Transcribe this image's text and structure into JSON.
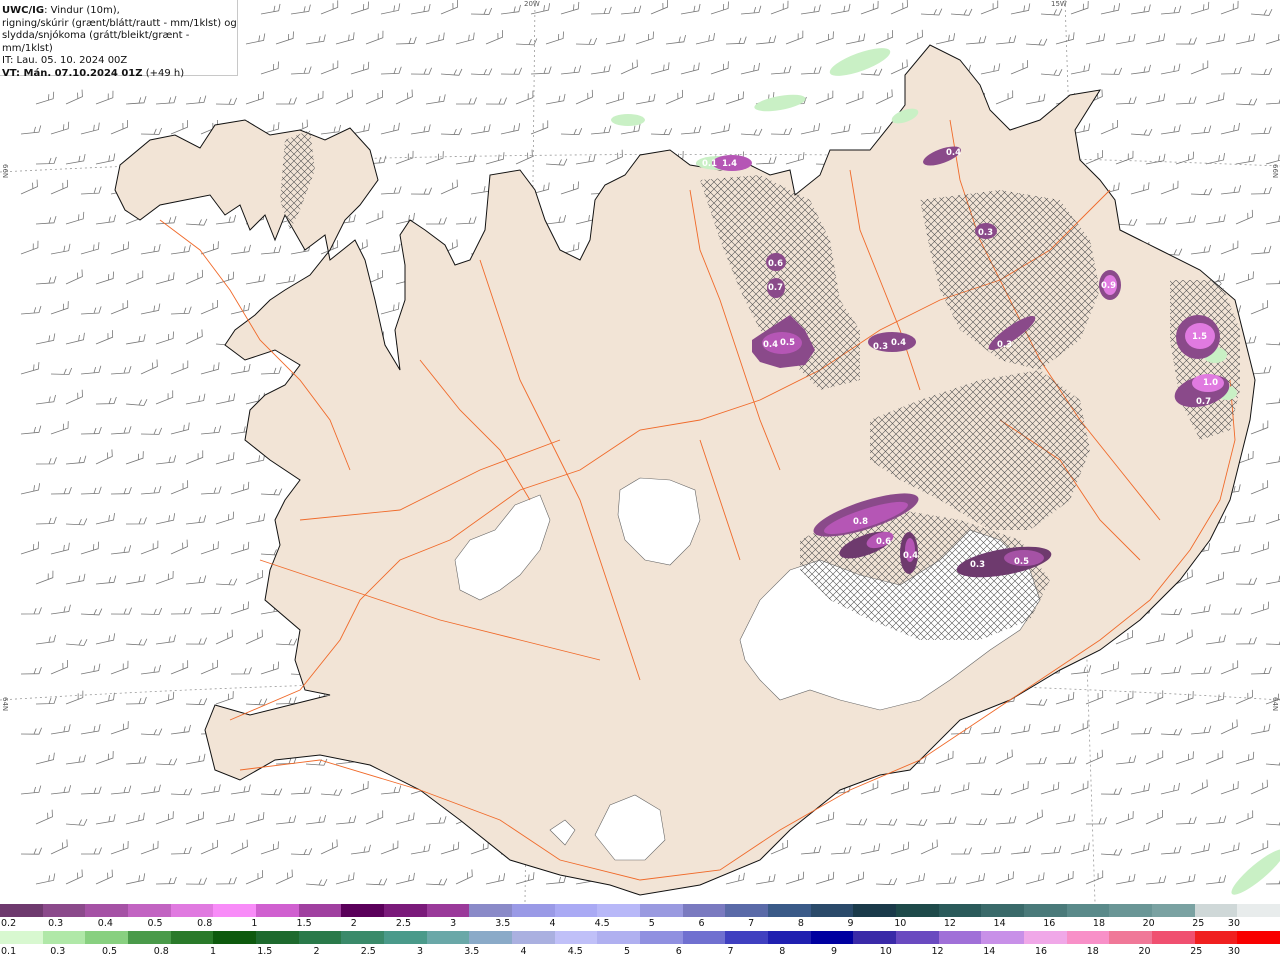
{
  "header": {
    "model": "UWC/IG",
    "line1_rest": ": Vindur (10m),",
    "line2": "rigning/skúrir (grænt/blátt/rautt - mm/1klst) og",
    "line3": "slydda/snjókoma (grátt/bleikt/grænt - mm/1klst)",
    "line4": "IT: Lau. 05. 10. 2024 00Z",
    "line5_label": "VT: Mán. 07.10.2024 01Z",
    "line5_rest": " (+49 h)"
  },
  "map_labels": {
    "lon_20w": "20W",
    "lon_15w": "15W",
    "lat_66n_left": "66N",
    "lat_66n_right": "66N",
    "lat_64n_left": "64N",
    "lat_64n_right": "64N"
  },
  "colors": {
    "land": "#f2e4d6",
    "sea": "#ffffff",
    "coast": "#111111",
    "roads": "#f06a2a",
    "glacier": "#ffffff",
    "rain": "#c9f0c5",
    "snow_light": "#8a4a8a",
    "snow_medium": "#b556b5",
    "snow_heavy": "#e07ae0"
  },
  "precip_values": [
    {
      "label": "0.1"
    },
    {
      "label": "1.4"
    },
    {
      "label": "0.4"
    },
    {
      "label": "0.3"
    },
    {
      "label": "0.6"
    },
    {
      "label": "0.7"
    },
    {
      "label": "0.4"
    },
    {
      "label": "0.5"
    },
    {
      "label": "0.3"
    },
    {
      "label": "0.4"
    },
    {
      "label": "0.3"
    },
    {
      "label": "0.9"
    },
    {
      "label": "1.5"
    },
    {
      "label": "1.0"
    },
    {
      "label": "0.7"
    },
    {
      "label": "0.8"
    },
    {
      "label": "0.6"
    },
    {
      "label": "0.4"
    },
    {
      "label": "0.3"
    },
    {
      "label": "0.5"
    }
  ],
  "legend_snow": {
    "colors": [
      "#6e3a6e",
      "#8b4a8b",
      "#a552a5",
      "#c264c2",
      "#e07ae0",
      "#f88cf8",
      "#d060d0",
      "#a040a0",
      "#5a005a",
      "#7a1a7a",
      "#9a3a9a",
      "#8a8ac8",
      "#9a9ae6",
      "#aaaaf4",
      "#b8b8f8",
      "#9a9ae0",
      "#7a7ac0",
      "#5a6aa8",
      "#3a5a88",
      "#2a4a6a",
      "#1a3a4a",
      "#1e4a4a",
      "#2a5a5a",
      "#3a6a6a",
      "#4a7a7a",
      "#5a8a8a",
      "#6a9696",
      "#7aa2a2",
      "#cfd8d8",
      "#e8ecec"
    ],
    "ticks": [
      "0.2",
      "0.3",
      "0.4",
      "0.5",
      "0.8",
      "1",
      "1.5",
      "2",
      "2.5",
      "3",
      "3.5",
      "4",
      "4.5",
      "5",
      "6",
      "7",
      "8",
      "9",
      "10",
      "12",
      "14",
      "16",
      "18",
      "20",
      "25",
      "30"
    ]
  },
  "legend_rain": {
    "colors": [
      "#d8f8d0",
      "#b0e8a8",
      "#88d080",
      "#4a9a4a",
      "#2a7a2a",
      "#0e5a0e",
      "#1e6a2e",
      "#2a7a4a",
      "#3a8a6a",
      "#4a9a8a",
      "#6aa8a8",
      "#8aaac8",
      "#aab0e0",
      "#c0c0f8",
      "#b0b0f0",
      "#9090e0",
      "#7070d0",
      "#4040c0",
      "#2020b0",
      "#0000a0",
      "#3a2aa8",
      "#6a4ac0",
      "#a070d8",
      "#c890e8",
      "#f0a8e8",
      "#f890c8",
      "#f07898",
      "#f05070",
      "#f02020",
      "#f80000"
    ],
    "ticks": [
      "0.1",
      "0.3",
      "0.5",
      "0.8",
      "1",
      "1.5",
      "2",
      "2.5",
      "3",
      "3.5",
      "4",
      "4.5",
      "5",
      "6",
      "7",
      "8",
      "9",
      "10",
      "12",
      "14",
      "16",
      "18",
      "20",
      "25",
      "30"
    ]
  }
}
